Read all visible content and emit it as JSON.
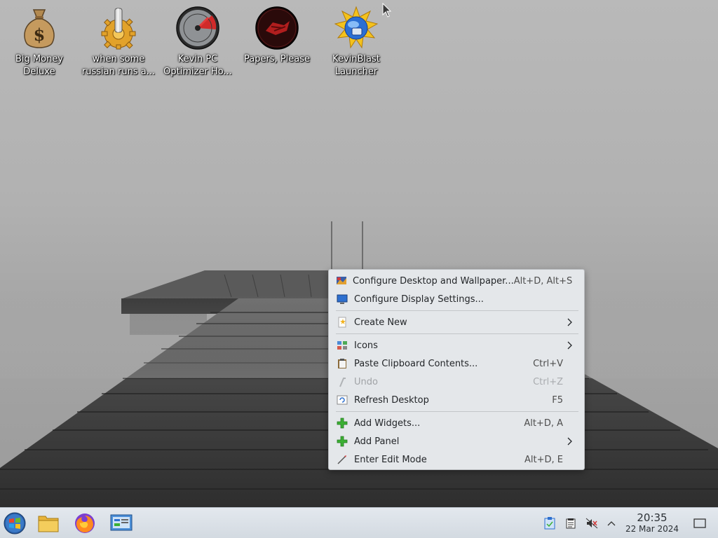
{
  "desktop": {
    "icons": [
      {
        "label": "Big Money Deluxe",
        "icon": "money-bag-icon"
      },
      {
        "label": "when some russian runs a...",
        "icon": "gear-icon"
      },
      {
        "label": "Kevin PC Optimizer Ho...",
        "icon": "speedometer-icon"
      },
      {
        "label": "Papers, Please",
        "icon": "papers-please-icon"
      },
      {
        "label": "KevinBlast Launcher",
        "icon": "kevinblast-icon"
      }
    ]
  },
  "context_menu": {
    "items": [
      {
        "label": "Configure Desktop and Wallpaper...",
        "shortcut": "Alt+D, Alt+S",
        "icon": "configure-desktop-icon"
      },
      {
        "label": "Configure Display Settings...",
        "shortcut": "",
        "icon": "display-settings-icon"
      },
      {
        "label": "Create New",
        "shortcut": "",
        "icon": "new-file-icon",
        "submenu": true
      },
      {
        "label": "Icons",
        "shortcut": "",
        "icon": "icons-view-icon",
        "submenu": true
      },
      {
        "label": "Paste Clipboard Contents...",
        "shortcut": "Ctrl+V",
        "icon": "paste-icon"
      },
      {
        "label": "Undo",
        "shortcut": "Ctrl+Z",
        "icon": "undo-icon",
        "disabled": true
      },
      {
        "label": "Refresh Desktop",
        "shortcut": "F5",
        "icon": "refresh-icon"
      },
      {
        "label": "Add Widgets...",
        "shortcut": "Alt+D, A",
        "icon": "add-icon"
      },
      {
        "label": "Add Panel",
        "shortcut": "",
        "icon": "add-icon",
        "submenu": true
      },
      {
        "label": "Enter Edit Mode",
        "shortcut": "Alt+D, E",
        "icon": "edit-mode-icon"
      }
    ]
  },
  "taskbar": {
    "launchers": [
      "start-menu-icon",
      "file-manager-icon",
      "firefox-icon",
      "system-settings-icon"
    ],
    "tray": [
      "clipboard-icon",
      "notes-icon",
      "muted-speaker-icon",
      "chevron-up-icon"
    ],
    "clock": {
      "time": "20:35",
      "date": "22 Mar 2024"
    },
    "show_desktop": "show-desktop-icon"
  },
  "colors": {
    "menu_bg": "#e4e7ea",
    "taskbar_bg": "#dde3e9",
    "add_green": "#3cb034"
  }
}
